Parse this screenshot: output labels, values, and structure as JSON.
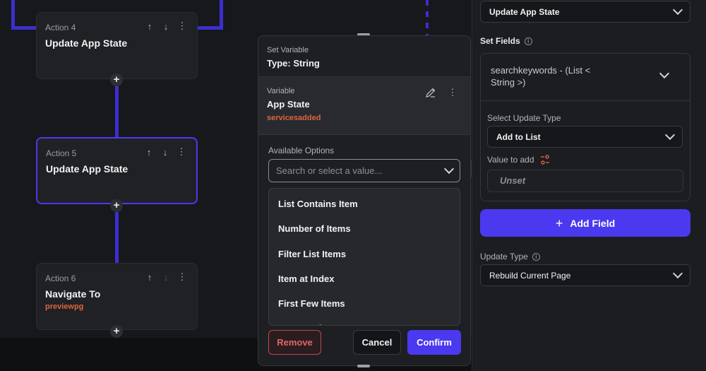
{
  "flow": {
    "actions": [
      {
        "label": "Action 4",
        "title": "Update App State",
        "subtitle": ""
      },
      {
        "label": "Action 5",
        "title": "Update App State",
        "subtitle": ""
      },
      {
        "label": "Action 6",
        "title": "Navigate To",
        "subtitle": "previewpg"
      }
    ],
    "add_symbol": "+"
  },
  "popup": {
    "header_label": "Set Variable",
    "header_value": "Type: String",
    "variable_label": "Variable",
    "variable_value": "App State",
    "variable_name": "servicesadded",
    "available_label": "Available Options",
    "search_placeholder": "Search or select a value...",
    "options": [
      "List Contains Item",
      "Number of Items",
      "Filter List Items",
      "Item at Index",
      "First Few Items",
      "Is Set and Not Empty"
    ],
    "remove_label": "Remove",
    "cancel_label": "Cancel",
    "confirm_label": "Confirm"
  },
  "panel": {
    "action_type": "Update App State",
    "set_fields_label": "Set Fields",
    "field_name": "searchkeywords - (List < String >)",
    "update_type_label": "Select Update Type",
    "update_type_value": "Add to List",
    "value_label": "Value to add",
    "value_placeholder": "Unset",
    "add_field_label": "Add Field",
    "page_update_label": "Update Type",
    "page_update_value": "Rebuild Current Page"
  },
  "colors": {
    "accent": "#4b39ef",
    "orange": "#e0643c",
    "danger": "#e46468",
    "background": "#17181b"
  }
}
